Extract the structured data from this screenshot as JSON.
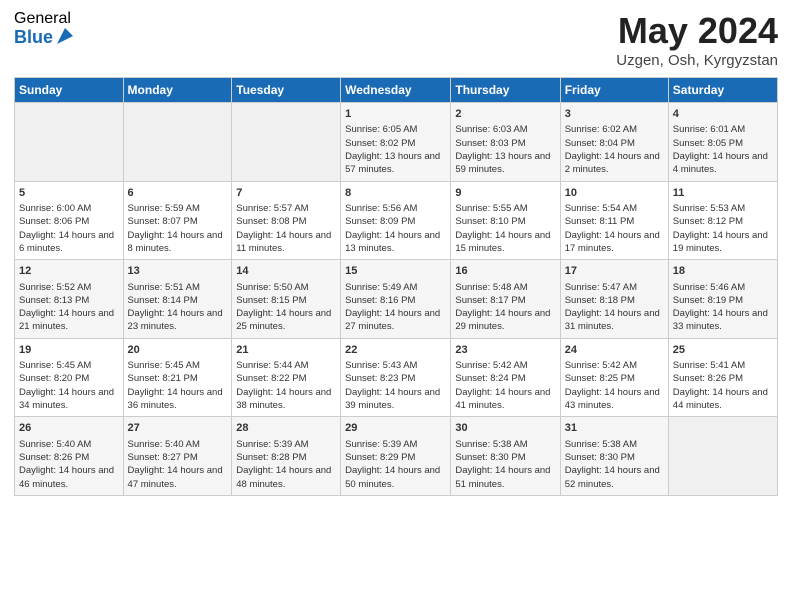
{
  "logo": {
    "general": "General",
    "blue": "Blue"
  },
  "title": "May 2024",
  "location": "Uzgen, Osh, Kyrgyzstan",
  "header": {
    "days": [
      "Sunday",
      "Monday",
      "Tuesday",
      "Wednesday",
      "Thursday",
      "Friday",
      "Saturday"
    ]
  },
  "weeks": [
    [
      {
        "day": "",
        "sunrise": "",
        "sunset": "",
        "daylight": ""
      },
      {
        "day": "",
        "sunrise": "",
        "sunset": "",
        "daylight": ""
      },
      {
        "day": "",
        "sunrise": "",
        "sunset": "",
        "daylight": ""
      },
      {
        "day": "1",
        "sunrise": "Sunrise: 6:05 AM",
        "sunset": "Sunset: 8:02 PM",
        "daylight": "Daylight: 13 hours and 57 minutes."
      },
      {
        "day": "2",
        "sunrise": "Sunrise: 6:03 AM",
        "sunset": "Sunset: 8:03 PM",
        "daylight": "Daylight: 13 hours and 59 minutes."
      },
      {
        "day": "3",
        "sunrise": "Sunrise: 6:02 AM",
        "sunset": "Sunset: 8:04 PM",
        "daylight": "Daylight: 14 hours and 2 minutes."
      },
      {
        "day": "4",
        "sunrise": "Sunrise: 6:01 AM",
        "sunset": "Sunset: 8:05 PM",
        "daylight": "Daylight: 14 hours and 4 minutes."
      }
    ],
    [
      {
        "day": "5",
        "sunrise": "Sunrise: 6:00 AM",
        "sunset": "Sunset: 8:06 PM",
        "daylight": "Daylight: 14 hours and 6 minutes."
      },
      {
        "day": "6",
        "sunrise": "Sunrise: 5:59 AM",
        "sunset": "Sunset: 8:07 PM",
        "daylight": "Daylight: 14 hours and 8 minutes."
      },
      {
        "day": "7",
        "sunrise": "Sunrise: 5:57 AM",
        "sunset": "Sunset: 8:08 PM",
        "daylight": "Daylight: 14 hours and 11 minutes."
      },
      {
        "day": "8",
        "sunrise": "Sunrise: 5:56 AM",
        "sunset": "Sunset: 8:09 PM",
        "daylight": "Daylight: 14 hours and 13 minutes."
      },
      {
        "day": "9",
        "sunrise": "Sunrise: 5:55 AM",
        "sunset": "Sunset: 8:10 PM",
        "daylight": "Daylight: 14 hours and 15 minutes."
      },
      {
        "day": "10",
        "sunrise": "Sunrise: 5:54 AM",
        "sunset": "Sunset: 8:11 PM",
        "daylight": "Daylight: 14 hours and 17 minutes."
      },
      {
        "day": "11",
        "sunrise": "Sunrise: 5:53 AM",
        "sunset": "Sunset: 8:12 PM",
        "daylight": "Daylight: 14 hours and 19 minutes."
      }
    ],
    [
      {
        "day": "12",
        "sunrise": "Sunrise: 5:52 AM",
        "sunset": "Sunset: 8:13 PM",
        "daylight": "Daylight: 14 hours and 21 minutes."
      },
      {
        "day": "13",
        "sunrise": "Sunrise: 5:51 AM",
        "sunset": "Sunset: 8:14 PM",
        "daylight": "Daylight: 14 hours and 23 minutes."
      },
      {
        "day": "14",
        "sunrise": "Sunrise: 5:50 AM",
        "sunset": "Sunset: 8:15 PM",
        "daylight": "Daylight: 14 hours and 25 minutes."
      },
      {
        "day": "15",
        "sunrise": "Sunrise: 5:49 AM",
        "sunset": "Sunset: 8:16 PM",
        "daylight": "Daylight: 14 hours and 27 minutes."
      },
      {
        "day": "16",
        "sunrise": "Sunrise: 5:48 AM",
        "sunset": "Sunset: 8:17 PM",
        "daylight": "Daylight: 14 hours and 29 minutes."
      },
      {
        "day": "17",
        "sunrise": "Sunrise: 5:47 AM",
        "sunset": "Sunset: 8:18 PM",
        "daylight": "Daylight: 14 hours and 31 minutes."
      },
      {
        "day": "18",
        "sunrise": "Sunrise: 5:46 AM",
        "sunset": "Sunset: 8:19 PM",
        "daylight": "Daylight: 14 hours and 33 minutes."
      }
    ],
    [
      {
        "day": "19",
        "sunrise": "Sunrise: 5:45 AM",
        "sunset": "Sunset: 8:20 PM",
        "daylight": "Daylight: 14 hours and 34 minutes."
      },
      {
        "day": "20",
        "sunrise": "Sunrise: 5:45 AM",
        "sunset": "Sunset: 8:21 PM",
        "daylight": "Daylight: 14 hours and 36 minutes."
      },
      {
        "day": "21",
        "sunrise": "Sunrise: 5:44 AM",
        "sunset": "Sunset: 8:22 PM",
        "daylight": "Daylight: 14 hours and 38 minutes."
      },
      {
        "day": "22",
        "sunrise": "Sunrise: 5:43 AM",
        "sunset": "Sunset: 8:23 PM",
        "daylight": "Daylight: 14 hours and 39 minutes."
      },
      {
        "day": "23",
        "sunrise": "Sunrise: 5:42 AM",
        "sunset": "Sunset: 8:24 PM",
        "daylight": "Daylight: 14 hours and 41 minutes."
      },
      {
        "day": "24",
        "sunrise": "Sunrise: 5:42 AM",
        "sunset": "Sunset: 8:25 PM",
        "daylight": "Daylight: 14 hours and 43 minutes."
      },
      {
        "day": "25",
        "sunrise": "Sunrise: 5:41 AM",
        "sunset": "Sunset: 8:26 PM",
        "daylight": "Daylight: 14 hours and 44 minutes."
      }
    ],
    [
      {
        "day": "26",
        "sunrise": "Sunrise: 5:40 AM",
        "sunset": "Sunset: 8:26 PM",
        "daylight": "Daylight: 14 hours and 46 minutes."
      },
      {
        "day": "27",
        "sunrise": "Sunrise: 5:40 AM",
        "sunset": "Sunset: 8:27 PM",
        "daylight": "Daylight: 14 hours and 47 minutes."
      },
      {
        "day": "28",
        "sunrise": "Sunrise: 5:39 AM",
        "sunset": "Sunset: 8:28 PM",
        "daylight": "Daylight: 14 hours and 48 minutes."
      },
      {
        "day": "29",
        "sunrise": "Sunrise: 5:39 AM",
        "sunset": "Sunset: 8:29 PM",
        "daylight": "Daylight: 14 hours and 50 minutes."
      },
      {
        "day": "30",
        "sunrise": "Sunrise: 5:38 AM",
        "sunset": "Sunset: 8:30 PM",
        "daylight": "Daylight: 14 hours and 51 minutes."
      },
      {
        "day": "31",
        "sunrise": "Sunrise: 5:38 AM",
        "sunset": "Sunset: 8:30 PM",
        "daylight": "Daylight: 14 hours and 52 minutes."
      },
      {
        "day": "",
        "sunrise": "",
        "sunset": "",
        "daylight": ""
      }
    ]
  ]
}
